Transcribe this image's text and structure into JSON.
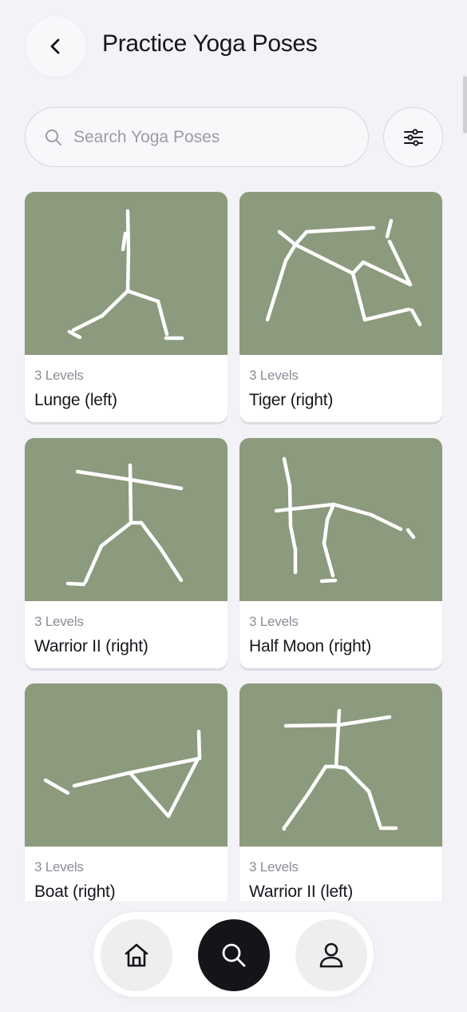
{
  "header": {
    "title": "Practice Yoga Poses"
  },
  "search": {
    "placeholder": "Search Yoga Poses",
    "value": ""
  },
  "colors": {
    "thumb_background": "#8c9a7d",
    "active_nav": "#131519",
    "page_background": "#f3f2f7"
  },
  "icons": {
    "back": "chevron-left-icon",
    "search": "search-icon",
    "filter": "sliders-icon",
    "home": "home-icon",
    "profile": "user-icon"
  },
  "poses": [
    {
      "levels": "3 Levels",
      "name": "Lunge (left)"
    },
    {
      "levels": "3 Levels",
      "name": "Tiger (right)"
    },
    {
      "levels": "3 Levels",
      "name": "Warrior II (right)"
    },
    {
      "levels": "3 Levels",
      "name": "Half Moon (right)"
    },
    {
      "levels": "3 Levels",
      "name": "Boat (right)"
    },
    {
      "levels": "3 Levels",
      "name": "Warrior II (left)"
    }
  ],
  "bottom_nav": {
    "items": [
      {
        "icon": "home-icon",
        "active": false
      },
      {
        "icon": "search-icon",
        "active": true
      },
      {
        "icon": "user-icon",
        "active": false
      }
    ]
  }
}
